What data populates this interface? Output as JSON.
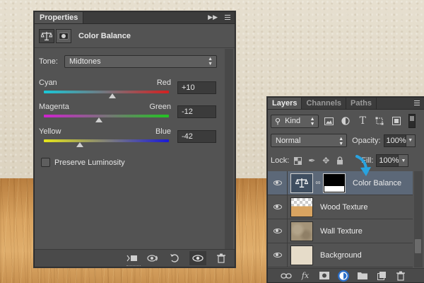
{
  "properties_panel": {
    "tab_label": "Properties",
    "title": "Color Balance",
    "tone_label": "Tone:",
    "tone_value": "Midtones",
    "sliders": [
      {
        "left_label": "Cyan",
        "right_label": "Red",
        "value": "+10",
        "position_fraction": 0.55,
        "gradient": [
          "#19c8d8",
          "#d42020"
        ]
      },
      {
        "left_label": "Magenta",
        "right_label": "Green",
        "value": "-12",
        "position_fraction": 0.44,
        "gradient": [
          "#cf22cf",
          "#22c422"
        ]
      },
      {
        "left_label": "Yellow",
        "right_label": "Blue",
        "value": "-42",
        "position_fraction": 0.29,
        "gradient": [
          "#e6e61a",
          "#1a1ad8"
        ]
      }
    ],
    "preserve_luminosity_label": "Preserve Luminosity",
    "preserve_luminosity_checked": false
  },
  "layers_panel": {
    "tabs": [
      "Layers",
      "Channels",
      "Paths"
    ],
    "filter_kind": "Kind",
    "blend_mode": "Normal",
    "opacity_label": "Opacity:",
    "opacity_value": "100%",
    "lock_label": "Lock:",
    "fill_label": "Fill:",
    "fill_value": "100%",
    "layers": [
      {
        "name": "Color Balance",
        "type": "adjustment",
        "selected": true
      },
      {
        "name": "Wood Texture",
        "type": "image",
        "selected": false
      },
      {
        "name": "Wall Texture",
        "type": "image",
        "selected": false
      },
      {
        "name": "Background",
        "type": "image",
        "selected": false
      }
    ],
    "footer_icons": [
      "link-icon",
      "fx-icon",
      "mask-icon",
      "adjustment-icon",
      "folder-icon",
      "new-layer-icon",
      "trash-icon"
    ]
  },
  "colors": {
    "panel_bg": "#535353",
    "selected_layer": "#5c6878",
    "annotation_arrow": "#29a3e0"
  }
}
